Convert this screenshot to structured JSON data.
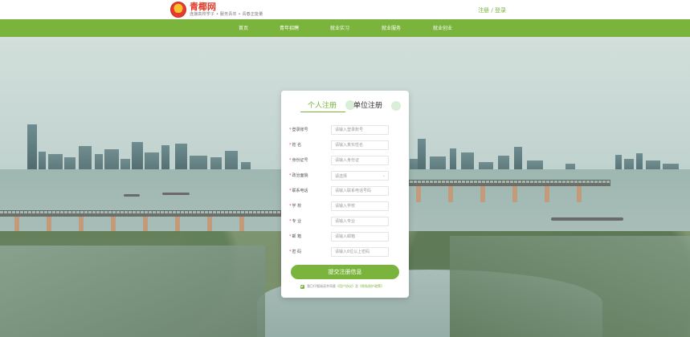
{
  "header": {
    "title": "青椰网",
    "slogan": "连接高校学子 • 服务青年 • 青春正能量",
    "auth": {
      "register": "注册",
      "separator": " / ",
      "login": "登录"
    }
  },
  "nav": {
    "items": [
      "首页",
      "青年招聘",
      "就业实习",
      "就业服务",
      "就业创业"
    ]
  },
  "form": {
    "tabs": {
      "personal": "个人注册",
      "unit": "单位注册"
    },
    "fields": [
      {
        "label": "登录账号",
        "placeholder": "请输入登录账号",
        "required": "*"
      },
      {
        "label": "姓 名",
        "placeholder": "请输入真实姓名",
        "required": "*"
      },
      {
        "label": "身份证号",
        "placeholder": "请输入身份证",
        "required": "*"
      },
      {
        "label": "政治面貌",
        "placeholder": "请选择",
        "required": "*"
      },
      {
        "label": "联系电话",
        "placeholder": "请输入联系电话号码",
        "required": "*"
      },
      {
        "label": "学 校",
        "placeholder": "请输入学校",
        "required": "*"
      },
      {
        "label": "专 业",
        "placeholder": "请输入专业",
        "required": "*"
      },
      {
        "label": "邮 箱",
        "placeholder": "请输入邮箱",
        "required": "*"
      },
      {
        "label": "密 码",
        "placeholder": "请输入6位以上密码",
        "required": "*"
      }
    ],
    "submit_label": "提交注册信息",
    "agreement": {
      "prefix": "我已仔细阅读并同意",
      "link1": "《用户协议》",
      "middle": "及",
      "link2": "《隐私保护政策》"
    }
  },
  "colors": {
    "brand_green": "#7ab43c",
    "brand_red": "#e23b2b"
  },
  "icons": {
    "logo": "youth-league-emblem-icon",
    "dropdown": "chevron-down-icon",
    "checkbox": "checkbox-checked-icon"
  }
}
